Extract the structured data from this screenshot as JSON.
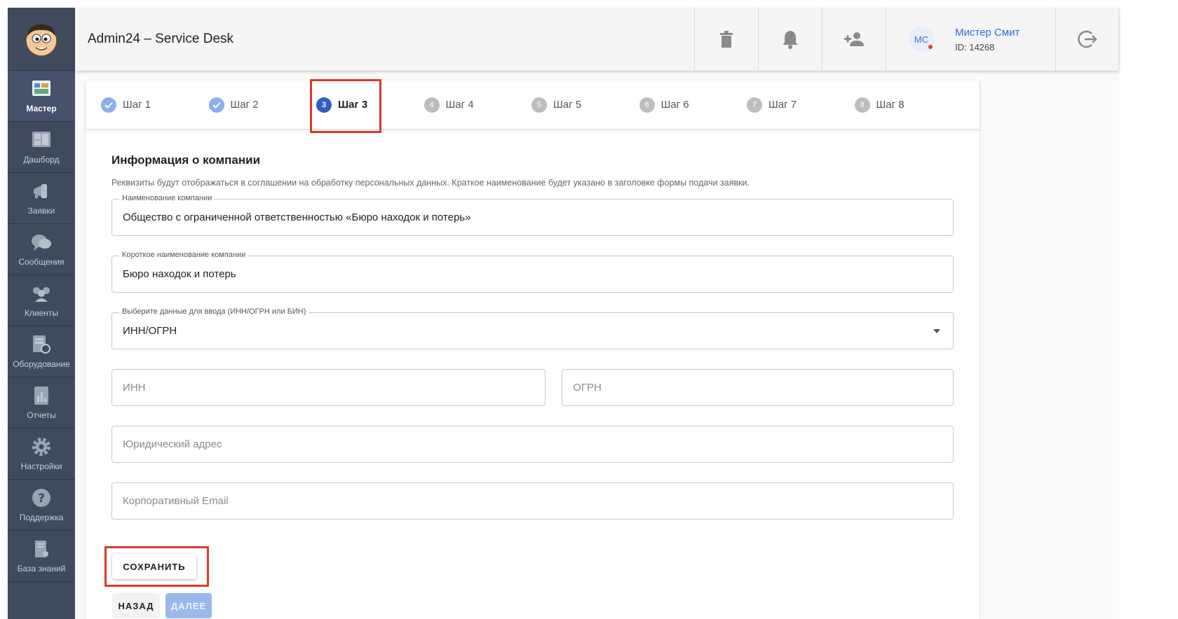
{
  "header": {
    "title": "Admin24 – Service Desk"
  },
  "user": {
    "initials": "МС",
    "name": "Мистер Смит",
    "id": "ID: 14268"
  },
  "sidebar": {
    "items": [
      {
        "label": "Мастер"
      },
      {
        "label": "Дашборд"
      },
      {
        "label": "Заявки"
      },
      {
        "label": "Сообщения"
      },
      {
        "label": "Клиенты"
      },
      {
        "label": "Оборудование"
      },
      {
        "label": "Отчеты"
      },
      {
        "label": "Настройки"
      },
      {
        "label": "Поддержка"
      },
      {
        "label": "База знаний"
      }
    ]
  },
  "steps": [
    {
      "num": "",
      "label": "Шаг 1"
    },
    {
      "num": "",
      "label": "Шаг 2"
    },
    {
      "num": "3",
      "label": "Шаг 3"
    },
    {
      "num": "4",
      "label": "Шаг 4"
    },
    {
      "num": "5",
      "label": "Шаг 5"
    },
    {
      "num": "6",
      "label": "Шаг 6"
    },
    {
      "num": "7",
      "label": "Шаг 7"
    },
    {
      "num": "8",
      "label": "Шаг 8"
    }
  ],
  "form": {
    "title": "Информация о компании",
    "description": "Реквизиты будут отображаться в соглашении на обработку персональных данных. Краткое наименование будет указано в заголовке формы подачи заявки.",
    "company_name": {
      "label": "Наименование компании",
      "value": "Общество с ограниченной ответственностью  «Бюро находок и потерь»"
    },
    "short_name": {
      "label": "Короткое наименование компании",
      "value": "Бюро находок и потерь"
    },
    "id_type": {
      "label": "Выберите данные для ввода (ИНН/ОГРН или БИН)",
      "value": "ИНН/ОГРН"
    },
    "inn": {
      "placeholder": "ИНН"
    },
    "ogrn": {
      "placeholder": "ОГРН"
    },
    "address": {
      "placeholder": "Юридический адрес"
    },
    "email": {
      "placeholder": "Корпоративный Email"
    }
  },
  "buttons": {
    "save": "СОХРАНИТЬ",
    "back": "НАЗАД",
    "next": "ДАЛЕЕ"
  },
  "colors": {
    "sidebar": "#3f4a5c",
    "accent": "#2f5fc4",
    "highlight": "#d93b2b"
  }
}
